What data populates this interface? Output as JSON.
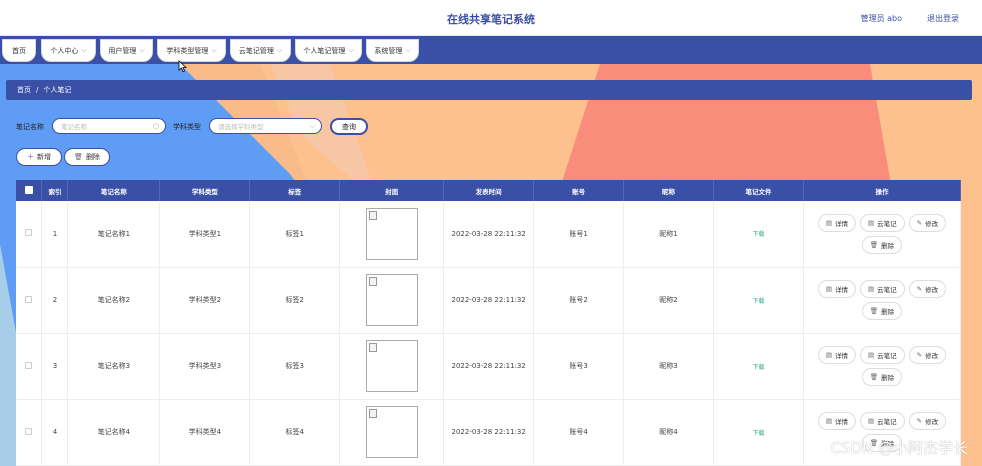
{
  "header": {
    "title": "在线共享笔记系统",
    "user": "管理员 abo",
    "logout": "退出登录"
  },
  "nav": {
    "items": [
      {
        "label": "首页",
        "chevron": false
      },
      {
        "label": "个人中心",
        "chevron": true
      },
      {
        "label": "用户管理",
        "chevron": true
      },
      {
        "label": "学科类型管理",
        "chevron": true
      },
      {
        "label": "云笔记管理",
        "chevron": true
      },
      {
        "label": "个人笔记管理",
        "chevron": true
      },
      {
        "label": "系统管理",
        "chevron": true
      }
    ]
  },
  "breadcrumb": {
    "home": "首页",
    "sep": "/",
    "current": "个人笔记"
  },
  "search": {
    "note_name_label": "笔记名称",
    "note_name_placeholder": "笔记名称",
    "subject_label": "学科类型",
    "subject_placeholder": "请选择学科类型",
    "query_button": "查询"
  },
  "actions": {
    "add": "新增",
    "delete": "删除"
  },
  "table": {
    "headers": [
      "",
      "索引",
      "笔记名称",
      "学科类型",
      "标签",
      "封面",
      "发表时间",
      "账号",
      "昵称",
      "笔记文件",
      "操作"
    ],
    "download_label": "下载",
    "op_labels": {
      "detail": "详情",
      "cloud": "云笔记",
      "edit": "修改",
      "delete": "删除"
    },
    "rows": [
      {
        "index": "1",
        "name": "笔记名称1",
        "subject": "学科类型1",
        "tag": "标签1",
        "time": "2022-03-28 22:11:32",
        "account": "账号1",
        "nickname": "昵称1"
      },
      {
        "index": "2",
        "name": "笔记名称2",
        "subject": "学科类型2",
        "tag": "标签2",
        "time": "2022-03-28 22:11:32",
        "account": "账号2",
        "nickname": "昵称2"
      },
      {
        "index": "3",
        "name": "笔记名称3",
        "subject": "学科类型3",
        "tag": "标签3",
        "time": "2022-03-28 22:11:32",
        "account": "账号3",
        "nickname": "昵称3"
      },
      {
        "index": "4",
        "name": "笔记名称4",
        "subject": "学科类型4",
        "tag": "标签4",
        "time": "2022-03-28 22:11:32",
        "account": "账号4",
        "nickname": "昵称4"
      }
    ]
  },
  "watermark": "CSDN @小阿杰学长",
  "colors": {
    "primary": "#3a4fa6",
    "download": "#2fa98b"
  }
}
